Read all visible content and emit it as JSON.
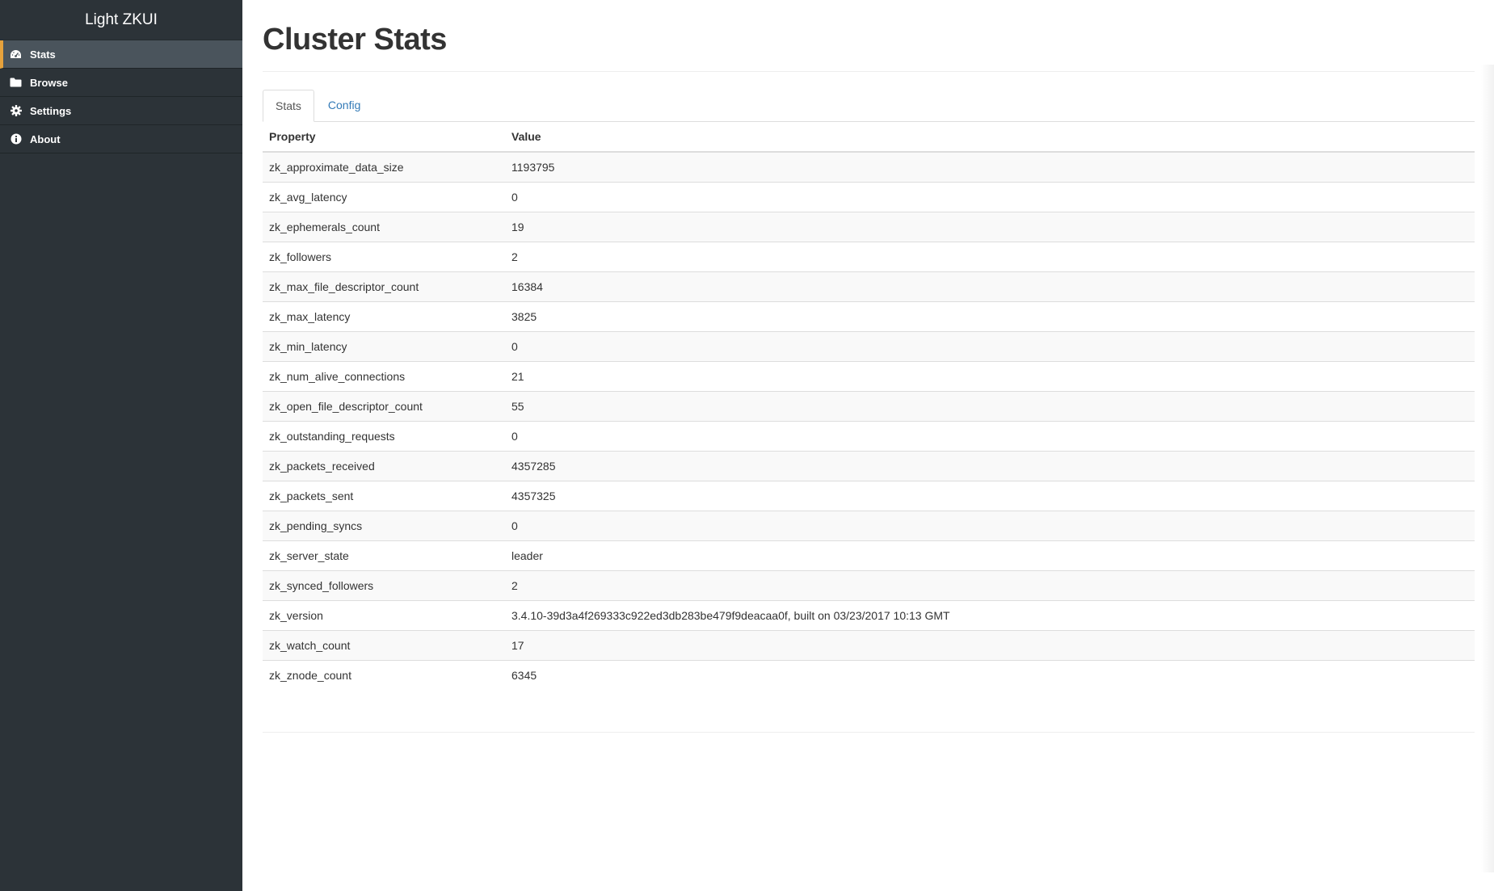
{
  "app": {
    "title": "Light ZKUI"
  },
  "sidebar": {
    "items": [
      {
        "label": "Stats",
        "icon": "dashboard-icon",
        "active": true
      },
      {
        "label": "Browse",
        "icon": "folder-icon",
        "active": false
      },
      {
        "label": "Settings",
        "icon": "gear-icon",
        "active": false
      },
      {
        "label": "About",
        "icon": "info-icon",
        "active": false
      }
    ]
  },
  "colors": {
    "sidebar_bg": "#2c3338",
    "active_item_bg": "#4a545c",
    "active_accent": "#e6a23c",
    "link": "#337ab7"
  },
  "main": {
    "title": "Cluster Stats",
    "tabs": [
      {
        "label": "Stats",
        "active": true
      },
      {
        "label": "Config",
        "active": false
      }
    ],
    "table": {
      "headers": [
        "Property",
        "Value"
      ],
      "rows": [
        [
          "zk_approximate_data_size",
          "1193795"
        ],
        [
          "zk_avg_latency",
          "0"
        ],
        [
          "zk_ephemerals_count",
          "19"
        ],
        [
          "zk_followers",
          "2"
        ],
        [
          "zk_max_file_descriptor_count",
          "16384"
        ],
        [
          "zk_max_latency",
          "3825"
        ],
        [
          "zk_min_latency",
          "0"
        ],
        [
          "zk_num_alive_connections",
          "21"
        ],
        [
          "zk_open_file_descriptor_count",
          "55"
        ],
        [
          "zk_outstanding_requests",
          "0"
        ],
        [
          "zk_packets_received",
          "4357285"
        ],
        [
          "zk_packets_sent",
          "4357325"
        ],
        [
          "zk_pending_syncs",
          "0"
        ],
        [
          "zk_server_state",
          "leader"
        ],
        [
          "zk_synced_followers",
          "2"
        ],
        [
          "zk_version",
          "3.4.10-39d3a4f269333c922ed3db283be479f9deacaa0f, built on 03/23/2017 10:13 GMT"
        ],
        [
          "zk_watch_count",
          "17"
        ],
        [
          "zk_znode_count",
          "6345"
        ]
      ]
    }
  }
}
